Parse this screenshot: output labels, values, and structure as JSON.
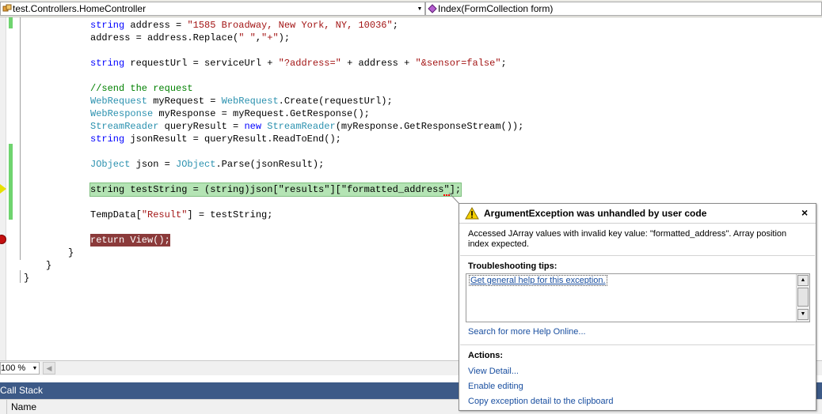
{
  "navbar": {
    "class_selector": "test.Controllers.HomeController",
    "member_selector": "Index(FormCollection form)"
  },
  "code": {
    "l1": {
      "kw": "string",
      "text1": " address = ",
      "str": "\"1585 Broadway, New York, NY, 10036\"",
      "end": ";"
    },
    "l2": {
      "text": "address = address.Replace(",
      "str1": "\" \"",
      "comma": ",",
      "str2": "\"+\"",
      "end": ");"
    },
    "l3": {
      "kw": "string",
      "text1": " requestUrl = serviceUrl + ",
      "str1": "\"?address=\"",
      "text2": " + address + ",
      "str2": "\"&sensor=false\"",
      "end": ";"
    },
    "l4": {
      "comment": "//send the request"
    },
    "l5": {
      "type1": "WebRequest",
      "text1": " myRequest = ",
      "type2": "WebRequest",
      "text2": ".Create(requestUrl);"
    },
    "l6": {
      "type1": "WebResponse",
      "text1": " myResponse = myRequest.GetResponse();"
    },
    "l7": {
      "type1": "StreamReader",
      "text1": " queryResult = ",
      "kw": "new",
      "sp": " ",
      "type2": "StreamReader",
      "text2": "(myResponse.GetResponseStream());"
    },
    "l8": {
      "kw": "string",
      "text1": " jsonResult = queryResult.ReadToEnd();"
    },
    "l9": {
      "type1": "JObject",
      "text1": " json = ",
      "type2": "JObject",
      "text2": ".Parse(jsonResult);"
    },
    "l10": {
      "text": "string testString = (string)json[\"results\"][\"formatted_address\"];"
    },
    "l11": {
      "text1": "TempData[",
      "str": "\"Result\"",
      "text2": "] = testString;"
    },
    "l12": {
      "text": "return View();"
    },
    "l13": {
      "text": "}"
    },
    "l14": {
      "text": "}"
    },
    "l15": {
      "text": "}"
    }
  },
  "zoom": {
    "value": "100 %"
  },
  "panel": {
    "title": "Call Stack",
    "column_name": "Name"
  },
  "exception": {
    "title": "ArgumentException was unhandled by user code",
    "close": "×",
    "message": "Accessed JArray values with invalid key value: \"formatted_address\". Array position index expected.",
    "tips_header": "Troubleshooting tips:",
    "tips_link": "Get general help for this exception.",
    "search_link": "Search for more Help Online...",
    "actions_header": "Actions:",
    "action_view_detail": "View Detail...",
    "action_enable_editing": "Enable editing",
    "action_copy": "Copy exception detail to the clipboard"
  },
  "colors": {
    "nav_background": "#ecebe6",
    "panel_title": "#3d5a87",
    "current_statement": "#b4e4b4",
    "breakpoint": "#8b3a3a",
    "keyword": "#0000ff",
    "type": "#2b91af",
    "string": "#a31515",
    "comment": "#008000",
    "link": "#1a4fa0"
  }
}
